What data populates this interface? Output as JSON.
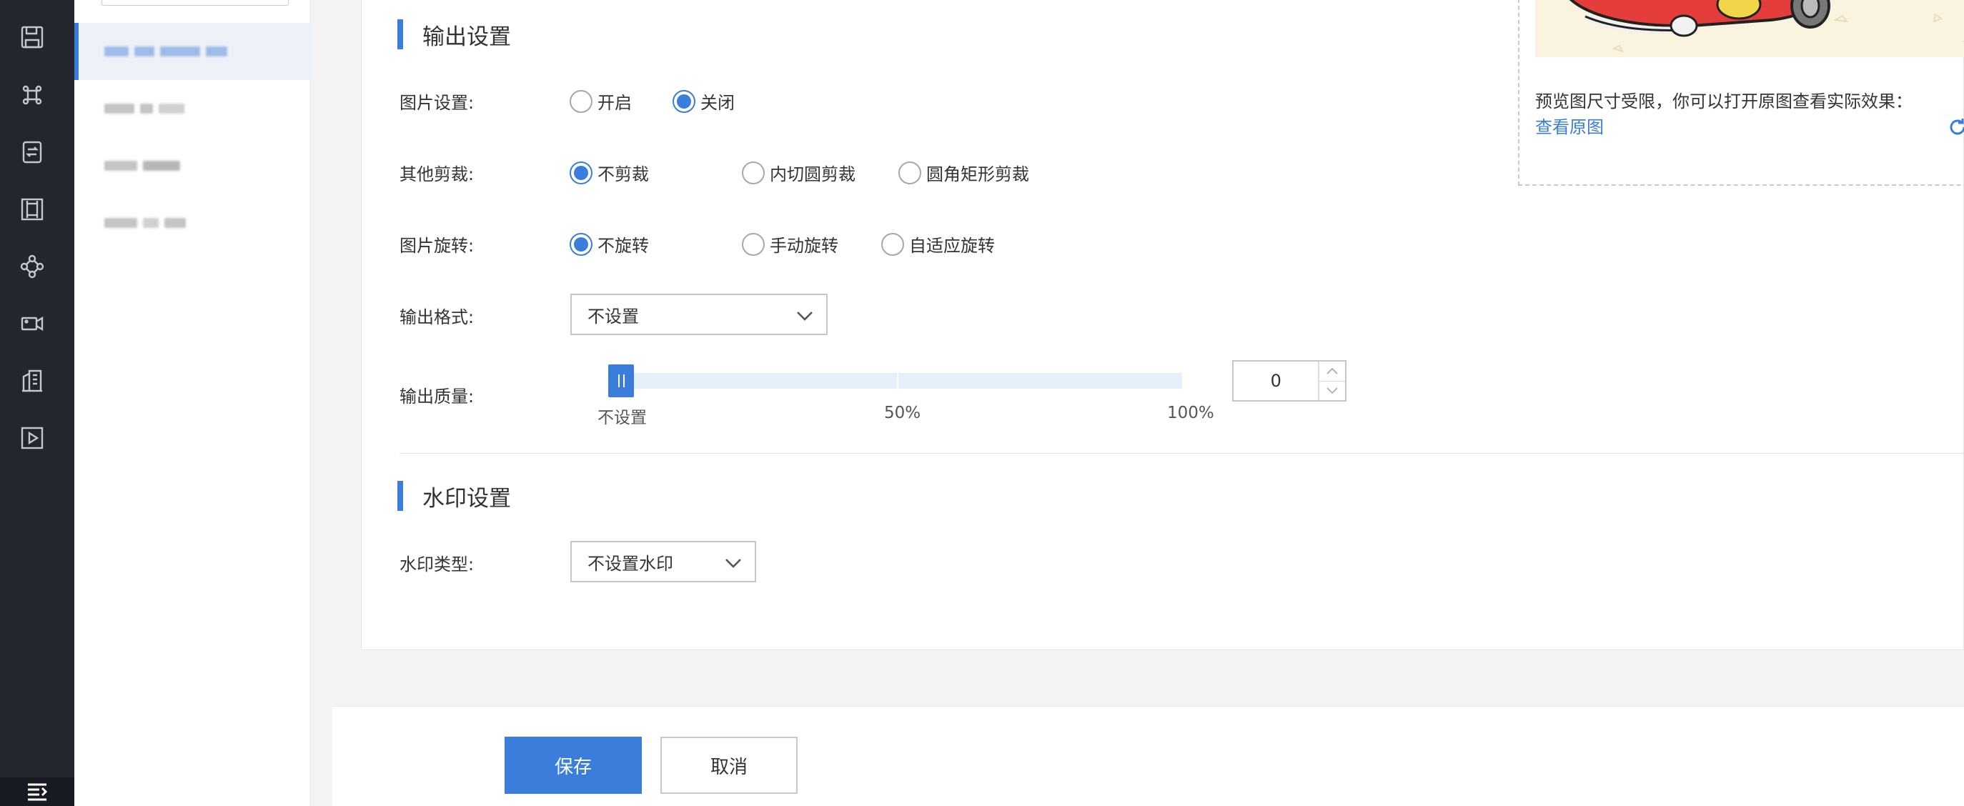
{
  "output_settings": {
    "title": "输出设置",
    "image_setting": {
      "label": "图片设置:",
      "options": [
        "开启",
        "关闭"
      ],
      "selected": "关闭"
    },
    "other_crop": {
      "label": "其他剪裁:",
      "options": [
        "不剪裁",
        "内切圆剪裁",
        "圆角矩形剪裁"
      ],
      "selected": "不剪裁"
    },
    "rotation": {
      "label": "图片旋转:",
      "options": [
        "不旋转",
        "手动旋转",
        "自适应旋转"
      ],
      "selected": "不旋转"
    },
    "format": {
      "label": "输出格式:",
      "value": "不设置"
    },
    "quality": {
      "label": "输出质量:",
      "value": "0",
      "slider_fraction": 0,
      "ticks": [
        "不设置",
        "50%",
        "100%"
      ]
    }
  },
  "watermark_settings": {
    "title": "水印设置",
    "type": {
      "label": "水印类型:",
      "value": "不设置水印"
    }
  },
  "preview": {
    "note": "预览图尺寸受限，你可以打开原图查看实际效果：",
    "view_original": "查看原图",
    "refresh": "刷新"
  },
  "footer": {
    "save": "保存",
    "cancel": "取消"
  },
  "colors": {
    "accent": "#3a7ddb",
    "rail": "#23262e"
  },
  "rail_icons": [
    "save-icon",
    "command-icon",
    "transcode-icon",
    "frame-icon",
    "network-icon",
    "camera-icon",
    "building-icon",
    "play-icon",
    "menu-collapse-icon"
  ]
}
